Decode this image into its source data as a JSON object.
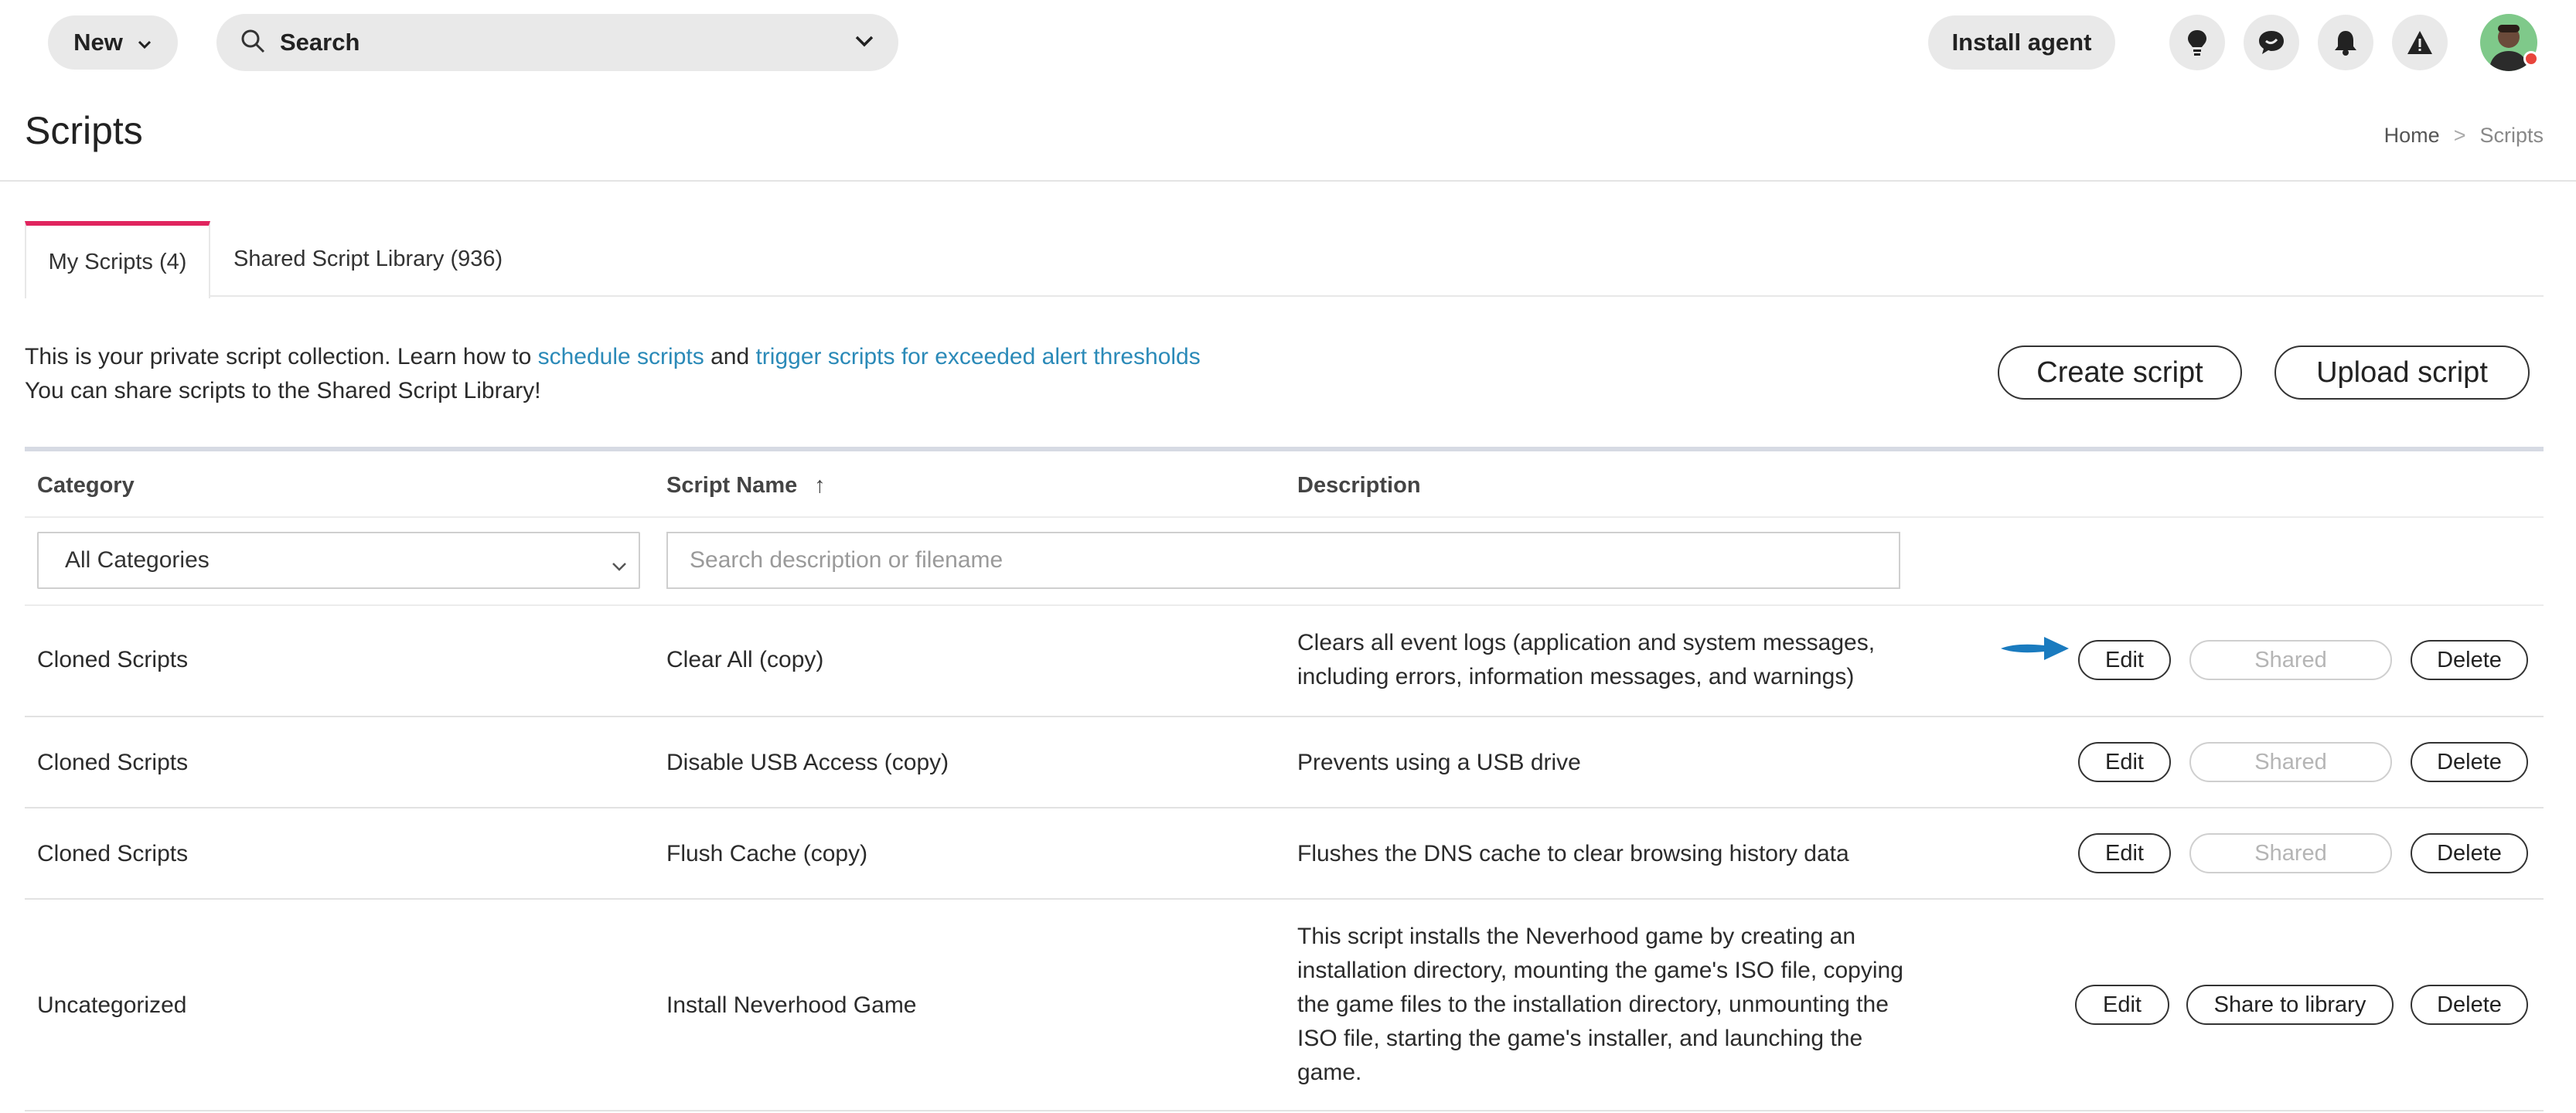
{
  "topbar": {
    "new_label": "New",
    "search_label": "Search",
    "install_label": "Install agent"
  },
  "page": {
    "title": "Scripts",
    "breadcrumb": {
      "home": "Home",
      "sep": ">",
      "current": "Scripts"
    }
  },
  "tabs": [
    {
      "label": "My Scripts (4)",
      "active": true
    },
    {
      "label": "Shared Script Library (936)",
      "active": false
    }
  ],
  "intro": {
    "line1_prefix": "This is your private script collection. Learn how to ",
    "link1": "schedule scripts",
    "line1_mid": " and ",
    "link2": "trigger scripts for exceeded alert thresholds",
    "line2": "You can share scripts to the Shared Script Library!"
  },
  "actions": {
    "create": "Create script",
    "upload": "Upload script"
  },
  "table": {
    "headers": {
      "category": "Category",
      "name": "Script Name",
      "sort_icon": "↑",
      "description": "Description"
    },
    "filters": {
      "category_value": "All Categories",
      "search_placeholder": "Search description or filename"
    },
    "rows": [
      {
        "category": "Cloned Scripts",
        "name": "Clear All (copy)",
        "description_lines": [
          "Clears all event logs (application and system messages,",
          "including errors, information messages, and warnings)"
        ],
        "edit": "Edit",
        "share": "Shared",
        "share_disabled": true,
        "delete": "Delete"
      },
      {
        "category": "Cloned Scripts",
        "name": "Disable USB Access (copy)",
        "description_lines": [
          "Prevents using a USB drive"
        ],
        "edit": "Edit",
        "share": "Shared",
        "share_disabled": true,
        "delete": "Delete"
      },
      {
        "category": "Cloned Scripts",
        "name": "Flush Cache (copy)",
        "description_lines": [
          "Flushes the DNS cache to clear browsing history data"
        ],
        "edit": "Edit",
        "share": "Shared",
        "share_disabled": true,
        "delete": "Delete"
      },
      {
        "category": "Uncategorized",
        "name": "Install Neverhood Game",
        "description_lines": [
          "This script installs the Neverhood game by creating an",
          "installation directory, mounting the game's ISO file, copying",
          "the game files to the installation directory, unmounting the",
          "ISO file, starting the game's installer, and launching the",
          "game."
        ],
        "edit": "Edit",
        "share": "Share to library",
        "share_disabled": false,
        "delete": "Delete"
      }
    ]
  },
  "colors": {
    "accent": "#e0245e",
    "link": "#2b8ab8",
    "arrow": "#1a7bbf",
    "pill_bg": "#e9e9e9"
  },
  "icons": [
    "chevron-down-icon",
    "search-icon",
    "lightbulb-icon",
    "chat-icon",
    "bell-icon",
    "warning-icon",
    "sort-up-icon",
    "arrow-right-icon"
  ]
}
